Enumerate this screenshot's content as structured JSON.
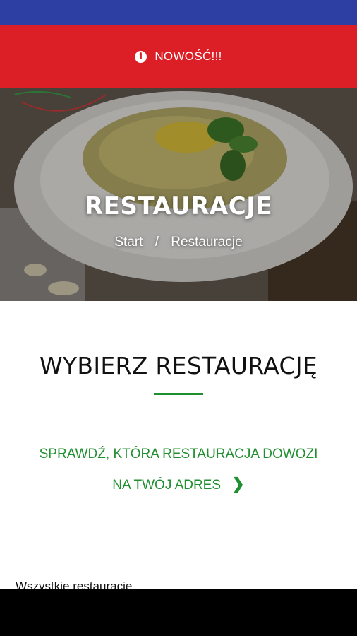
{
  "colors": {
    "status_bar": "#2d3fa3",
    "news_bar": "#dc1f26",
    "accent_green": "#1f8f2f"
  },
  "news_banner": {
    "icon": "info-icon",
    "text": "NOWOŚĆ!!!"
  },
  "hero": {
    "title": "RESTAURACJE",
    "breadcrumb": {
      "home": "Start",
      "separator": "/",
      "current": "Restauracje"
    }
  },
  "main": {
    "title": "WYBIERZ RESTAURACJĘ",
    "delivery_link": {
      "line1": "SPRAWDŹ, KTÓRA RESTAURACJA DOWOZI",
      "line2": "NA TWÓJ ADRES",
      "icon": "chevron-right-icon"
    },
    "all_restaurants_label": "Wszystkie restauracje"
  }
}
